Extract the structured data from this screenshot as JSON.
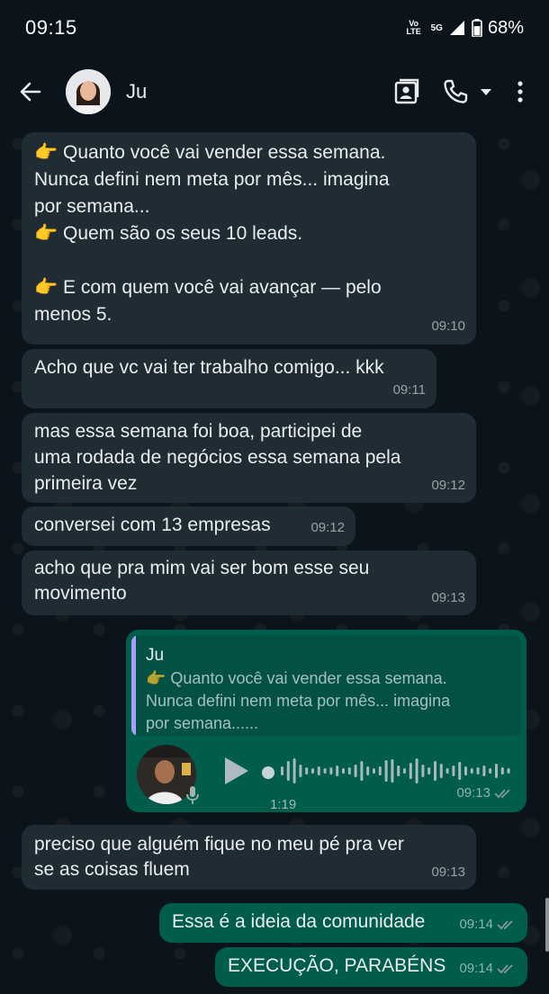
{
  "status_bar": {
    "time": "09:15",
    "volte_top": "Vo",
    "volte_bottom": "LTE",
    "network": "5G",
    "battery": "68%"
  },
  "header": {
    "contact_name": "Ju",
    "icons": [
      "back-arrow-icon",
      "contact-card-icon",
      "phone-icon",
      "dropdown-icon",
      "more-vert-icon"
    ]
  },
  "messages": [
    {
      "dir": "in",
      "text": "👉 Quanto você vai vender essa semana.\nNunca defini nem meta por mês... imagina\npor semana...\n👉 Quem são os seus 10 leads.\n\n👉 E com quem você vai avançar — pelo\nmenos 5.",
      "time": "09:10"
    },
    {
      "dir": "in",
      "text": "Acho que vc vai ter trabalho comigo... kkk",
      "time": "09:11"
    },
    {
      "dir": "in",
      "text": "mas essa semana foi boa, participei de\numa rodada de negócios essa semana pela\nprimeira vez",
      "time": "09:12"
    },
    {
      "dir": "in",
      "text": "conversei com 13 empresas",
      "time": "09:12"
    },
    {
      "dir": "in",
      "text": "acho que pra mim vai ser bom esse seu\nmovimento",
      "time": "09:13"
    },
    {
      "dir": "out",
      "type": "voice",
      "quote_author": "Ju",
      "quote_text": "👉 Quanto você vai vender essa semana.\nNunca defini nem meta por mês... imagina\npor semana......",
      "duration": "1:19",
      "time": "09:13"
    },
    {
      "dir": "in",
      "text": "preciso que alguém fique no meu pé pra ver\nse as coisas fluem",
      "time": "09:13"
    },
    {
      "dir": "out",
      "text": "Essa é a ideia da comunidade",
      "time": "09:14"
    },
    {
      "dir": "out",
      "text": "EXECUÇÃO, PARABÉNS",
      "time": "09:14"
    }
  ],
  "colors": {
    "background": "#0b141a",
    "incoming_bubble": "#202c33",
    "outgoing_bubble": "#005c4b",
    "quote_bar": "#a5a0ff",
    "read_ticks": "#8696a0"
  }
}
